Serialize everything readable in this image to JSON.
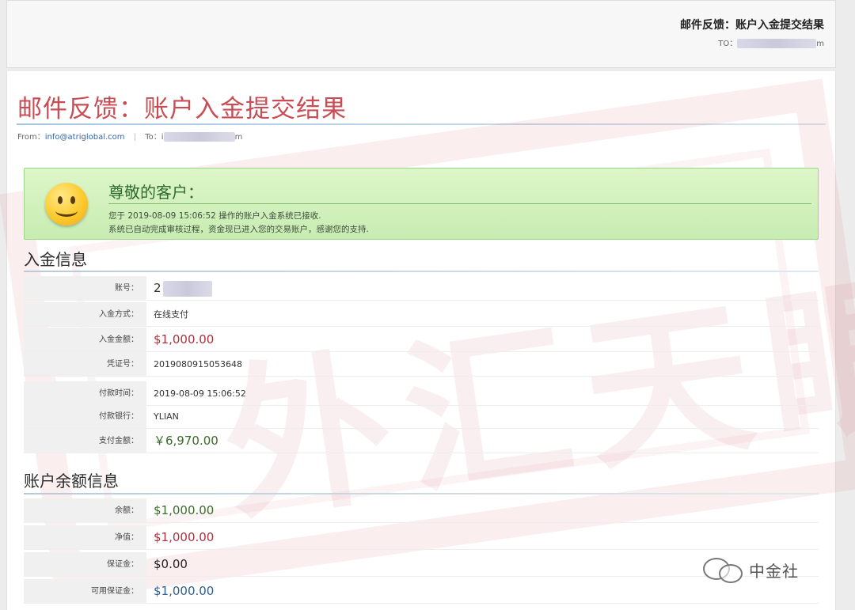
{
  "header": {
    "title": "邮件反馈：账户入金提交结果",
    "to_label": "TO：",
    "to_suffix": "m"
  },
  "email": {
    "title": "邮件反馈：账户入金提交结果",
    "from_label": "From：",
    "from_address": "info@atriglobal.com",
    "to_label": "To：",
    "to_prefix": "i",
    "to_suffix": "m"
  },
  "banner": {
    "greeting": "尊敬的客户：",
    "message_line1": "您于 2019-08-09 15:06:52 操作的账户入金系统已接收.",
    "message_line2": "系统已自动完成审核过程，资金现已进入您的交易账户，感谢您的支持."
  },
  "deposit_info": {
    "title": "入金信息",
    "rows": [
      {
        "label": "账号：",
        "value": "2",
        "color": "#333333"
      },
      {
        "label": "入金方式：",
        "value": "在线支付",
        "color": "#333333"
      },
      {
        "label": "入金金额：",
        "value": "$1,000.00",
        "color": "#a8323c"
      },
      {
        "label": "凭证号：",
        "value": "2019080915053648",
        "color": "#333333"
      },
      {
        "label": "付款时间：",
        "value": "2019-08-09 15:06:52",
        "color": "#333333"
      },
      {
        "label": "付款银行：",
        "value": "YLIAN",
        "color": "#333333"
      },
      {
        "label": "支付金额：",
        "value": "￥6,970.00",
        "color": "#3a6b2a"
      }
    ]
  },
  "balance_info": {
    "title": "账户余额信息",
    "rows": [
      {
        "label": "余额：",
        "value": "$1,000.00",
        "color": "#3a6b2a"
      },
      {
        "label": "净值：",
        "value": "$1,000.00",
        "color": "#a8323c"
      },
      {
        "label": "保证金：",
        "value": "$0.00",
        "color": "#222222"
      },
      {
        "label": "可用保证金：",
        "value": "$1,000.00",
        "color": "#2e5d8c"
      }
    ]
  },
  "watermark": {
    "stamp_text": "外汇天眼",
    "wechat_text": "中金社"
  },
  "colors": {
    "title_red": "#c84d55",
    "banner_green": "#c8ecb2"
  }
}
